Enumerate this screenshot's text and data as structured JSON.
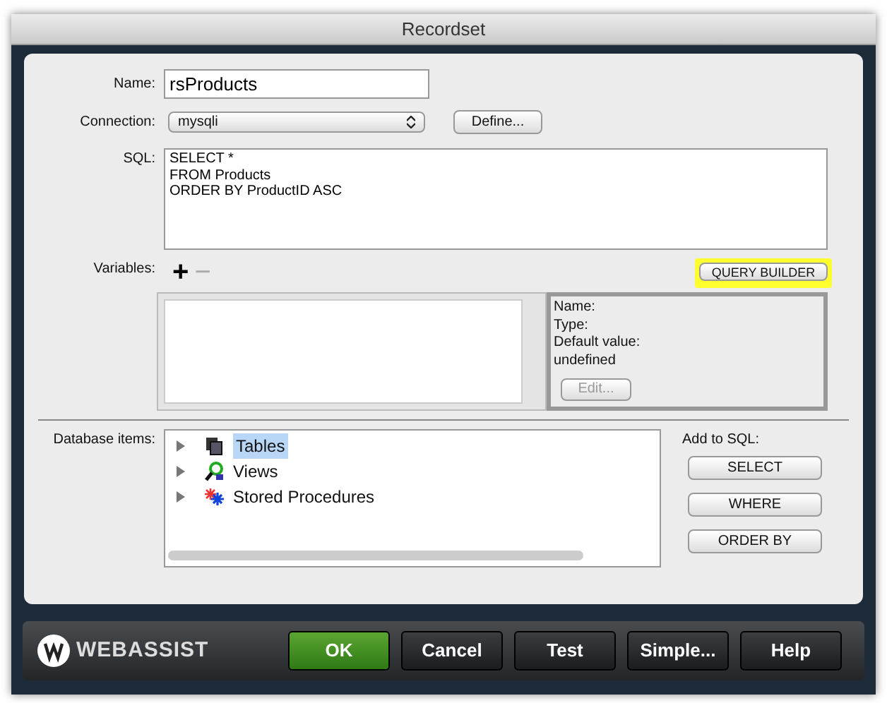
{
  "window": {
    "title": "Recordset"
  },
  "name": {
    "label": "Name:",
    "value": "rsProducts"
  },
  "connection": {
    "label": "Connection:",
    "value": "mysqli",
    "button": "Define..."
  },
  "sql": {
    "label": "SQL:",
    "value": "SELECT *\nFROM Products\nORDER BY ProductID ASC"
  },
  "variables": {
    "label": "Variables:",
    "add": "+",
    "remove": "−",
    "query_builder": {
      "label": "QUERY BUILDER",
      "highlighted": true
    },
    "details": [
      "Name:",
      "Type:",
      "Default value:",
      "undefined"
    ],
    "edit": {
      "label": "Edit...",
      "disabled": true
    }
  },
  "database_items": {
    "label": "Database items:",
    "items": [
      {
        "label": "Tables",
        "kind": "tables",
        "expanded": false,
        "selected": true
      },
      {
        "label": "Views",
        "kind": "views",
        "expanded": false,
        "selected": false
      },
      {
        "label": "Stored Procedures",
        "kind": "procedures",
        "expanded": false,
        "selected": false
      }
    ]
  },
  "add_to_sql": {
    "label": "Add to SQL:",
    "buttons": [
      "SELECT",
      "WHERE",
      "ORDER BY"
    ]
  },
  "footer": {
    "logo": "WEBASSIST",
    "buttons": [
      {
        "label": "OK",
        "kind": "primary"
      },
      {
        "label": "Cancel",
        "kind": "normal"
      },
      {
        "label": "Test",
        "kind": "normal"
      },
      {
        "label": "Simple...",
        "kind": "normal"
      },
      {
        "label": "Help",
        "kind": "normal"
      }
    ]
  }
}
